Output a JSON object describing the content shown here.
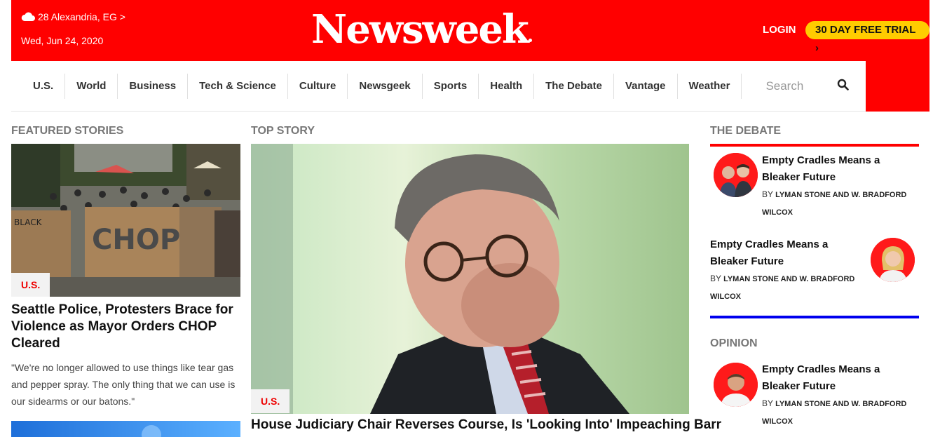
{
  "header": {
    "weather": "28 Alexandria, EG >",
    "date": "Wed, Jun 24, 2020",
    "logo": "Newsweek",
    "login": "LOGIN",
    "trial": "30 DAY FREE TRIAL ›"
  },
  "nav": {
    "items": [
      "U.S.",
      "World",
      "Business",
      "Tech & Science",
      "Culture",
      "Newsgeek",
      "Sports",
      "Health",
      "The Debate",
      "Vantage",
      "Weather"
    ],
    "search_placeholder": "Search"
  },
  "featured": {
    "label": "FEATURED STORIES",
    "tag": "U.S.",
    "title": "Seattle Police, Protesters Brace for Violence as Mayor Orders CHOP Cleared",
    "quote": "\"We're no longer allowed to use things like tear gas and pepper spray. The only thing that we can use is our sidearms or our batons.\"",
    "image_signs": [
      "BLACK",
      "CHOP"
    ]
  },
  "top_story": {
    "label": "TOP STORY",
    "tag": "U.S.",
    "title": "House Judiciary Chair Reverses Course, Is 'Looking Into' Impeaching Barr"
  },
  "debate": {
    "label": "THE DEBATE",
    "items": [
      {
        "title": "Empty Cradles Means a Bleaker Future",
        "by": "BY",
        "authors": "LYMAN STONE AND W. BRADFORD WILCOX"
      },
      {
        "title": "Empty Cradles Means a Bleaker Future",
        "by": "BY",
        "authors": "LYMAN STONE AND W. BRADFORD WILCOX"
      }
    ]
  },
  "opinion": {
    "label": "OPINION",
    "items": [
      {
        "title": "Empty Cradles Means a Bleaker Future",
        "by": "BY",
        "authors": "LYMAN STONE AND W. BRADFORD WILCOX"
      }
    ]
  },
  "colors": {
    "brand_red": "#ff0000",
    "trial_yellow": "#ffcc00",
    "debate_rule": "#ff0000",
    "opinion_rule": "#0000ee"
  }
}
